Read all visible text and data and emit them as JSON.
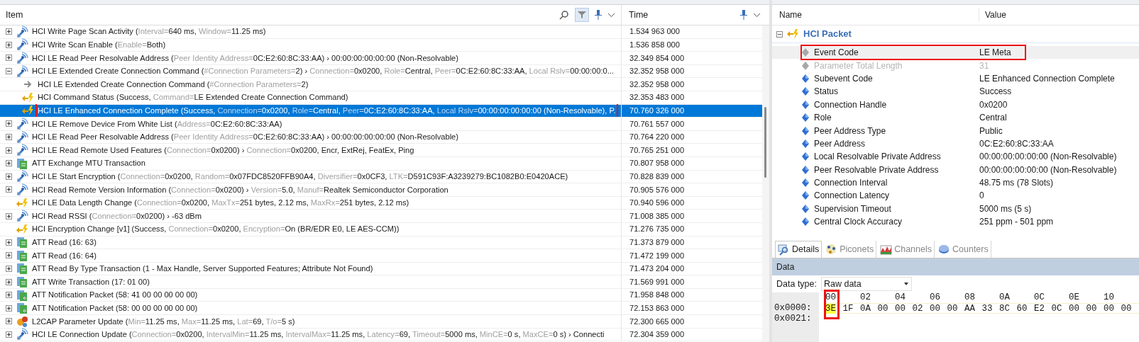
{
  "event_list": {
    "columns": [
      {
        "label": "Item"
      },
      {
        "label": "Time"
      }
    ],
    "rows": [
      {
        "kind": "command",
        "expandable": true,
        "expanded": false,
        "selected": false,
        "annotated": false,
        "parts": [
          "HCI Write Page Scan Activity (",
          "Interval=",
          "640 ms, ",
          "Window=",
          "11.25 ms)"
        ],
        "time": "1.534 963 000"
      },
      {
        "kind": "command",
        "expandable": true,
        "expanded": false,
        "selected": false,
        "annotated": false,
        "parts": [
          "HCI Write Scan Enable (",
          "Enable=",
          "Both)"
        ],
        "time": "1.536 858 000"
      },
      {
        "kind": "command",
        "expandable": true,
        "expanded": false,
        "selected": false,
        "annotated": false,
        "parts": [
          "HCI LE Read Peer Resolvable Address (",
          "Peer Identity Address=",
          "0C:E2:60:8C:33:AA) › 00:00:00:00:00:00 (Non-Resolvable)"
        ],
        "time": "32.349 854 000"
      },
      {
        "kind": "command",
        "expandable": true,
        "expanded": true,
        "selected": false,
        "annotated": false,
        "parts": [
          "HCI LE Extended Create Connection Command (",
          "#Connection Parameters=",
          "2) › ",
          "Connection=",
          "0x0200, ",
          "Role=",
          "Central, ",
          "Peer=",
          "0C:E2:60:8C:33:AA, ",
          "Local Rslv=",
          "00:00:00:0..."
        ],
        "time": "32.352 958 000",
        "children": [
          {
            "kind": "arrow",
            "expandable": false,
            "selected": false,
            "annotated": false,
            "parts": [
              "HCI LE Extended Create Connection Command (",
              "#Connection Parameters=",
              "2)"
            ],
            "time": "32.352 958 000"
          },
          {
            "kind": "event",
            "expandable": false,
            "selected": false,
            "annotated": false,
            "parts": [
              "HCI Command Status (Success, ",
              "Command=",
              "LE Extended Create Connection Command)"
            ],
            "time": "32.353 483 000"
          },
          {
            "kind": "event",
            "expandable": false,
            "selected": true,
            "annotated": true,
            "parts": [
              "HCI LE Enhanced Connection Complete (Success, ",
              "Connection=",
              "0x0200, ",
              "Role=",
              "Central, ",
              "Peer=",
              "0C:E2:60:8C:33:AA, ",
              "Local Rslv=",
              "00:00:00:00:00:00 (Non-Resolvable), P."
            ],
            "time": "70.760 326 000"
          }
        ]
      },
      {
        "kind": "command",
        "expandable": true,
        "expanded": false,
        "selected": false,
        "annotated": false,
        "parts": [
          "HCI LE Remove Device From White List (",
          "Address=",
          "0C:E2:60:8C:33:AA)"
        ],
        "time": "70.761 557 000"
      },
      {
        "kind": "command",
        "expandable": true,
        "expanded": false,
        "selected": false,
        "annotated": false,
        "parts": [
          "HCI LE Read Peer Resolvable Address (",
          "Peer Identity Address=",
          "0C:E2:60:8C:33:AA) › 00:00:00:00:00:00 (Non-Resolvable)"
        ],
        "time": "70.764 220 000"
      },
      {
        "kind": "command",
        "expandable": true,
        "expanded": false,
        "selected": false,
        "annotated": false,
        "parts": [
          "HCI LE Read Remote Used Features (",
          "Connection=",
          "0x0200) › ",
          "Connection=",
          "0x0200, Encr, ExtRej, FeatEx, Ping"
        ],
        "time": "70.765 251 000"
      },
      {
        "kind": "att",
        "expandable": true,
        "expanded": false,
        "selected": false,
        "annotated": false,
        "parts": [
          "ATT Exchange MTU Transaction"
        ],
        "time": "70.807 958 000"
      },
      {
        "kind": "command",
        "expandable": true,
        "expanded": false,
        "selected": false,
        "annotated": false,
        "parts": [
          "HCI LE Start Encryption (",
          "Connection=",
          "0x0200, ",
          "Random=",
          "0x07FDC8520FFB90A4, ",
          "Diversifier=",
          "0x0CF3, ",
          "LTK=",
          "D591C93F:A3239279:BC1082B0:E0420ACE)"
        ],
        "time": "70.828 839 000"
      },
      {
        "kind": "command",
        "expandable": true,
        "expanded": false,
        "selected": false,
        "annotated": false,
        "parts": [
          "HCI Read Remote Version Information (",
          "Connection=",
          "0x0200) › ",
          "Version=",
          "5.0, ",
          "Manuf=",
          "Realtek Semiconductor Corporation"
        ],
        "time": "70.905 576 000"
      },
      {
        "kind": "event",
        "expandable": false,
        "selected": false,
        "annotated": false,
        "parts": [
          "HCI LE Data Length Change (",
          "Connection=",
          "0x0200, ",
          "MaxTx=",
          "251 bytes, 2.12 ms, ",
          "MaxRx=",
          "251 bytes, 2.12 ms)"
        ],
        "time": "70.940 596 000"
      },
      {
        "kind": "command",
        "expandable": true,
        "expanded": false,
        "selected": false,
        "annotated": false,
        "parts": [
          "HCI Read RSSI (",
          "Connection=",
          "0x0200) › -63 dBm"
        ],
        "time": "71.008 385 000"
      },
      {
        "kind": "event",
        "expandable": false,
        "selected": false,
        "annotated": false,
        "parts": [
          "HCI Encryption Change [v1] (Success, ",
          "Connection=",
          "0x0200, ",
          "Encryption=",
          "On (BR/EDR E0, LE AES-CCM))"
        ],
        "time": "71.276 735 000"
      },
      {
        "kind": "att",
        "expandable": true,
        "expanded": false,
        "selected": false,
        "annotated": false,
        "parts": [
          "ATT Read (16: 63)"
        ],
        "time": "71.373 879 000"
      },
      {
        "kind": "att",
        "expandable": true,
        "expanded": false,
        "selected": false,
        "annotated": false,
        "parts": [
          "ATT Read (16: 64)"
        ],
        "time": "71.472 199 000"
      },
      {
        "kind": "att",
        "expandable": true,
        "expanded": false,
        "selected": false,
        "annotated": false,
        "parts": [
          "ATT Read By Type Transaction (1 - Max Handle, Server Supported Features; Attribute Not Found)"
        ],
        "time": "71.473 204 000"
      },
      {
        "kind": "att",
        "expandable": true,
        "expanded": false,
        "selected": false,
        "annotated": false,
        "parts": [
          "ATT Write Transaction (17: 01 00)"
        ],
        "time": "71.569 991 000"
      },
      {
        "kind": "notify",
        "expandable": true,
        "expanded": false,
        "selected": false,
        "annotated": false,
        "parts": [
          "ATT Notification Packet (58: 41 00 00 00 00 00)"
        ],
        "time": "71.958 848 000"
      },
      {
        "kind": "notify",
        "expandable": true,
        "expanded": false,
        "selected": false,
        "annotated": false,
        "parts": [
          "ATT Notification Packet (58: 00 00 00 00 00 00)"
        ],
        "time": "72.153 863 000"
      },
      {
        "kind": "l2cap",
        "expandable": true,
        "expanded": false,
        "selected": false,
        "annotated": false,
        "parts": [
          "L2CAP Parameter Update (",
          "Min=",
          "11.25 ms, ",
          "Max=",
          "11.25 ms, ",
          "Lat=",
          "69, ",
          "T/o=",
          "5 s)"
        ],
        "time": "72.300 665 000"
      },
      {
        "kind": "command",
        "expandable": true,
        "expanded": false,
        "selected": false,
        "annotated": false,
        "parts": [
          "HCI LE Connection Update (",
          "Connection=",
          "0x0200, ",
          "IntervalMin=",
          "11.25 ms, ",
          "IntervalMax=",
          "11.25 ms, ",
          "Latency=",
          "69, ",
          "Timeout=",
          "5000 ms, ",
          "MinCE=",
          "0 s, ",
          "MaxCE=",
          "0 s) › Connecti"
        ],
        "time": "72.304 359 000"
      }
    ]
  },
  "details": {
    "columns": [
      {
        "label": "Name"
      },
      {
        "label": "Value"
      }
    ],
    "group": {
      "title": "HCI Packet",
      "expanded": true
    },
    "fields": [
      {
        "kind": "fixed",
        "name": "Event Code",
        "value": "LE Meta",
        "disabled": false,
        "selected": true,
        "annotated": true
      },
      {
        "kind": "fixed",
        "name": "Parameter Total Length",
        "value": "31",
        "disabled": true,
        "selected": false,
        "annotated": false
      },
      {
        "kind": "param",
        "name": "Subevent Code",
        "value": "LE Enhanced Connection Complete",
        "disabled": false,
        "selected": false,
        "annotated": false
      },
      {
        "kind": "param",
        "name": "Status",
        "value": "Success",
        "disabled": false,
        "selected": false,
        "annotated": false
      },
      {
        "kind": "param",
        "name": "Connection Handle",
        "value": "0x0200",
        "disabled": false,
        "selected": false,
        "annotated": false
      },
      {
        "kind": "param",
        "name": "Role",
        "value": "Central",
        "disabled": false,
        "selected": false,
        "annotated": false
      },
      {
        "kind": "param",
        "name": "Peer Address Type",
        "value": "Public",
        "disabled": false,
        "selected": false,
        "annotated": false
      },
      {
        "kind": "param",
        "name": "Peer Address",
        "value": "0C:E2:60:8C:33:AA",
        "disabled": false,
        "selected": false,
        "annotated": false
      },
      {
        "kind": "param",
        "name": "Local Resolvable Private Address",
        "value": "00:00:00:00:00:00 (Non-Resolvable)",
        "disabled": false,
        "selected": false,
        "annotated": false
      },
      {
        "kind": "param",
        "name": "Peer Resolvable Private Address",
        "value": "00:00:00:00:00:00 (Non-Resolvable)",
        "disabled": false,
        "selected": false,
        "annotated": false
      },
      {
        "kind": "param",
        "name": "Connection Interval",
        "value": "48.75 ms (78 Slots)",
        "disabled": false,
        "selected": false,
        "annotated": false
      },
      {
        "kind": "param",
        "name": "Connection Latency",
        "value": "0",
        "disabled": false,
        "selected": false,
        "annotated": false
      },
      {
        "kind": "param",
        "name": "Supervision Timeout",
        "value": "5000 ms (5 s)",
        "disabled": false,
        "selected": false,
        "annotated": false
      },
      {
        "kind": "param",
        "name": "Central Clock Accuracy",
        "value": "251 ppm - 501 ppm",
        "disabled": false,
        "selected": false,
        "annotated": false
      }
    ]
  },
  "tabs": [
    {
      "kind": "details",
      "label": "Details",
      "selected": true
    },
    {
      "kind": "piconets",
      "label": "Piconets",
      "selected": false
    },
    {
      "kind": "channels",
      "label": "Channels",
      "selected": false
    },
    {
      "kind": "counters",
      "label": "Counters",
      "selected": false
    }
  ],
  "data": {
    "title": "Data",
    "type_label": "Data type:",
    "type_value": "Raw data",
    "columns": [
      "00",
      "02",
      "04",
      "06",
      "08",
      "0A",
      "0C",
      "0E",
      "10"
    ],
    "rows": [
      {
        "offset": "0x0000:",
        "bytes": [
          {
            "v": "3E",
            "selected": true,
            "annotated": true
          },
          {
            "v": "1F",
            "selected": false,
            "annotated": false
          },
          {
            "v": "0A",
            "selected": false,
            "annotated": false
          },
          {
            "v": "00",
            "selected": false,
            "annotated": false
          },
          {
            "v": "00",
            "selected": false,
            "annotated": false
          },
          {
            "v": "02",
            "selected": false,
            "annotated": false
          },
          {
            "v": "00",
            "selected": false,
            "annotated": false
          },
          {
            "v": "00",
            "selected": false,
            "annotated": false
          },
          {
            "v": "AA",
            "selected": false,
            "annotated": false
          },
          {
            "v": "33",
            "selected": false,
            "annotated": false
          },
          {
            "v": "8C",
            "selected": false,
            "annotated": false
          },
          {
            "v": "60",
            "selected": false,
            "annotated": false
          },
          {
            "v": "E2",
            "selected": false,
            "annotated": false
          },
          {
            "v": "0C",
            "selected": false,
            "annotated": false
          },
          {
            "v": "00",
            "selected": false,
            "annotated": false
          },
          {
            "v": "00",
            "selected": false,
            "annotated": false
          },
          {
            "v": "00",
            "selected": false,
            "annotated": false
          },
          {
            "v": "00",
            "selected": false,
            "annotated": false
          }
        ]
      },
      {
        "offset": "0x0021:",
        "bytes": []
      }
    ]
  }
}
